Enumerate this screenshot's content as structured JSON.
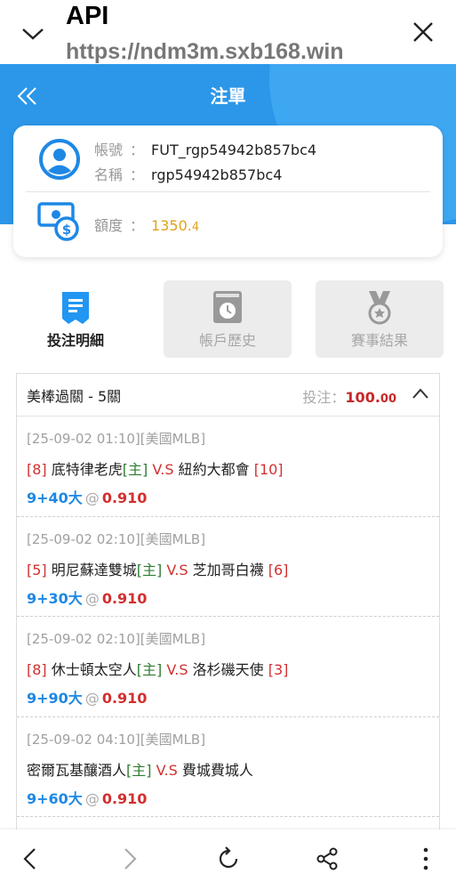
{
  "topbar": {
    "title": "API",
    "url": "https://ndm3m.sxb168.win"
  },
  "header": {
    "title": "注單"
  },
  "account": {
    "account_label": "帳號",
    "account_value": "FUT_rgp54942b857bc4",
    "name_label": "名稱",
    "name_value": "rgp54942b857bc4",
    "credit_label": "額度",
    "credit_value_main": "1350.",
    "credit_value_small": "4",
    "separator": "："
  },
  "tabs": [
    {
      "label": "投注明細",
      "active": true
    },
    {
      "label": "帳戶歷史",
      "active": false
    },
    {
      "label": "賽事結果",
      "active": false
    }
  ],
  "panel": {
    "title": "美棒過關 - 5關",
    "stake_label": "投注：",
    "stake_main": "100.",
    "stake_small": "00"
  },
  "bets": [
    {
      "datetime": "[25-09-02 01:10][美國MLB]",
      "home_rank": "[8]",
      "home": "底特律老虎",
      "home_tag": "[主]",
      "vs": "V.S",
      "away": "紐約大都會",
      "away_rank": "[10]",
      "pick": "9+40大",
      "at": "@",
      "odds": "0.910"
    },
    {
      "datetime": "[25-09-02 02:10][美國MLB]",
      "home_rank": "[5]",
      "home": "明尼蘇達雙城",
      "home_tag": "[主]",
      "vs": "V.S",
      "away": "芝加哥白襪",
      "away_rank": "[6]",
      "pick": "9+30大",
      "at": "@",
      "odds": "0.910"
    },
    {
      "datetime": "[25-09-02 02:10][美國MLB]",
      "home_rank": "[8]",
      "home": "休士頓太空人",
      "home_tag": "[主]",
      "vs": "V.S",
      "away": "洛杉磯天使",
      "away_rank": "[3]",
      "pick": "9+90大",
      "at": "@",
      "odds": "0.910"
    },
    {
      "datetime": "[25-09-02 04:10][美國MLB]",
      "home_rank": "",
      "home": "密爾瓦基釀酒人",
      "home_tag": "[主]",
      "vs": "V.S",
      "away": "費城費城人",
      "away_rank": "",
      "pick": "9+60大",
      "at": "@",
      "odds": "0.910"
    }
  ],
  "colors": {
    "brand_blue": "#2c97e8",
    "gold": "#e2a21a",
    "red": "#d32f2f",
    "green": "#2e7d32",
    "pick_blue": "#1e88e5"
  },
  "icons": {
    "topbar": [
      "chevron-down-icon",
      "close-icon"
    ],
    "header": [
      "double-chevron-left-icon"
    ],
    "account": [
      "user-avatar-icon",
      "money-icon"
    ],
    "tabs": [
      "document-icon",
      "clock-book-icon",
      "medal-icon"
    ],
    "panel": [
      "chevron-up-icon"
    ],
    "bottombar": [
      "back-icon",
      "forward-icon",
      "refresh-icon",
      "share-icon",
      "more-vertical-icon"
    ]
  }
}
